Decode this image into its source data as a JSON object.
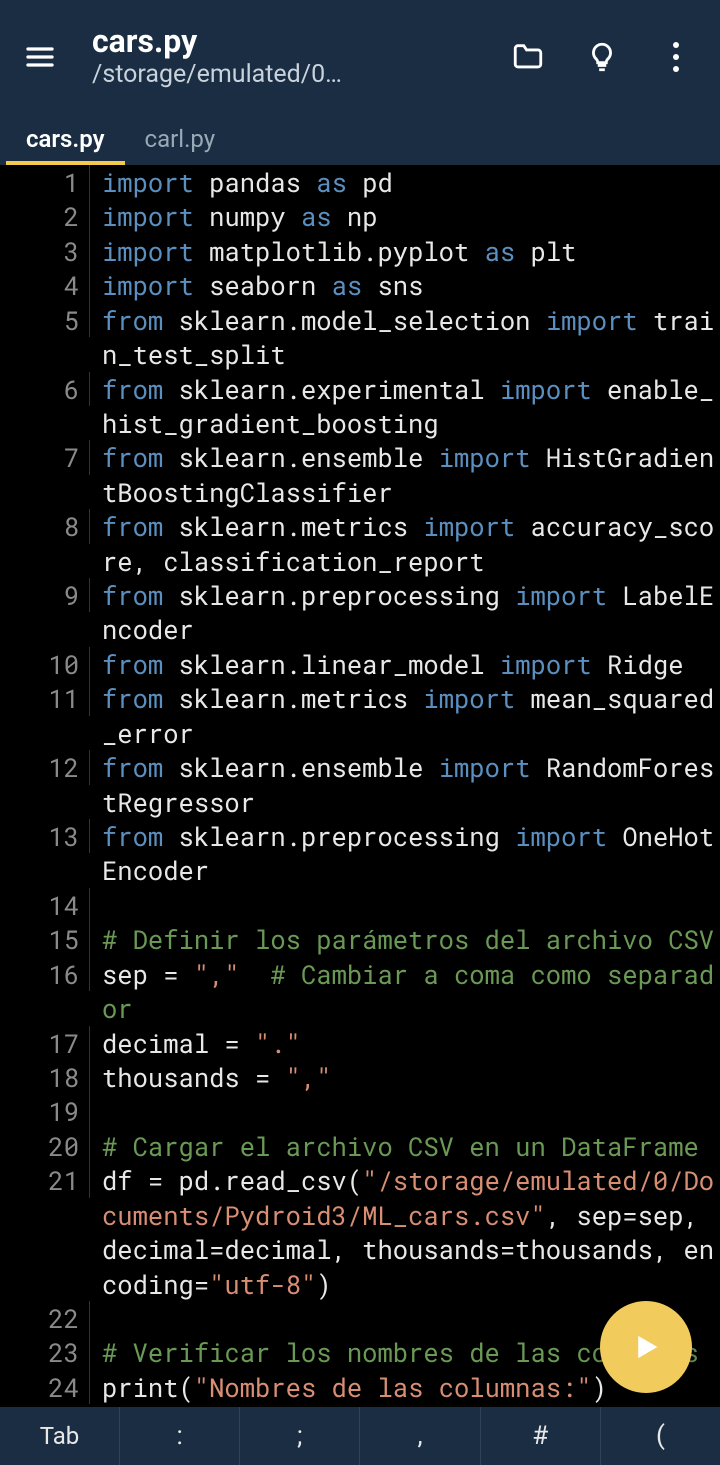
{
  "header": {
    "title": "cars.py",
    "subtitle": "/storage/emulated/0…"
  },
  "tabs": [
    {
      "label": "cars.py",
      "active": true
    },
    {
      "label": "carl.py",
      "active": false
    }
  ],
  "code_lines": [
    {
      "n": 1,
      "tokens": [
        [
          "kw-import",
          "import"
        ],
        [
          "sp",
          " "
        ],
        [
          "ident",
          "pandas"
        ],
        [
          "sp",
          " "
        ],
        [
          "kw-as",
          "as"
        ],
        [
          "sp",
          " "
        ],
        [
          "ident",
          "pd"
        ]
      ]
    },
    {
      "n": 2,
      "tokens": [
        [
          "kw-import",
          "import"
        ],
        [
          "sp",
          " "
        ],
        [
          "ident",
          "numpy"
        ],
        [
          "sp",
          " "
        ],
        [
          "kw-as",
          "as"
        ],
        [
          "sp",
          " "
        ],
        [
          "ident",
          "np"
        ]
      ]
    },
    {
      "n": 3,
      "tokens": [
        [
          "kw-import",
          "import"
        ],
        [
          "sp",
          " "
        ],
        [
          "ident",
          "matplotlib.pyplot"
        ],
        [
          "sp",
          " "
        ],
        [
          "kw-as",
          "as"
        ],
        [
          "sp",
          " "
        ],
        [
          "ident",
          "plt"
        ]
      ]
    },
    {
      "n": 4,
      "tokens": [
        [
          "kw-import",
          "import"
        ],
        [
          "sp",
          " "
        ],
        [
          "ident",
          "seaborn"
        ],
        [
          "sp",
          " "
        ],
        [
          "kw-as",
          "as"
        ],
        [
          "sp",
          " "
        ],
        [
          "ident",
          "sns"
        ]
      ]
    },
    {
      "n": 5,
      "tokens": [
        [
          "kw-from",
          "from"
        ],
        [
          "sp",
          " "
        ],
        [
          "ident",
          "sklearn.model_selection"
        ],
        [
          "sp",
          " "
        ],
        [
          "kw-import",
          "import"
        ],
        [
          "sp",
          " "
        ],
        [
          "ident",
          "train_test_split"
        ]
      ]
    },
    {
      "n": 6,
      "tokens": [
        [
          "kw-from",
          "from"
        ],
        [
          "sp",
          " "
        ],
        [
          "ident",
          "sklearn.experimental"
        ],
        [
          "sp",
          " "
        ],
        [
          "kw-import",
          "import"
        ],
        [
          "sp",
          " "
        ],
        [
          "ident",
          "enable_hist_gradient_boosting"
        ]
      ]
    },
    {
      "n": 7,
      "tokens": [
        [
          "kw-from",
          "from"
        ],
        [
          "sp",
          " "
        ],
        [
          "ident",
          "sklearn.ensemble"
        ],
        [
          "sp",
          " "
        ],
        [
          "kw-import",
          "import"
        ],
        [
          "sp",
          " "
        ],
        [
          "ident",
          "HistGradientBoostingClassifier"
        ]
      ]
    },
    {
      "n": 8,
      "tokens": [
        [
          "kw-from",
          "from"
        ],
        [
          "sp",
          " "
        ],
        [
          "ident",
          "sklearn.metrics"
        ],
        [
          "sp",
          " "
        ],
        [
          "kw-import",
          "import"
        ],
        [
          "sp",
          " "
        ],
        [
          "ident",
          "accuracy_score, classification_report"
        ]
      ]
    },
    {
      "n": 9,
      "tokens": [
        [
          "kw-from",
          "from"
        ],
        [
          "sp",
          " "
        ],
        [
          "ident",
          "sklearn.preprocessing"
        ],
        [
          "sp",
          " "
        ],
        [
          "kw-import",
          "import"
        ],
        [
          "sp",
          " "
        ],
        [
          "ident",
          "LabelEncoder"
        ]
      ]
    },
    {
      "n": 10,
      "tokens": [
        [
          "kw-from",
          "from"
        ],
        [
          "sp",
          " "
        ],
        [
          "ident",
          "sklearn.linear_model"
        ],
        [
          "sp",
          " "
        ],
        [
          "kw-import",
          "import"
        ],
        [
          "sp",
          " "
        ],
        [
          "ident",
          "Ridge"
        ]
      ]
    },
    {
      "n": 11,
      "tokens": [
        [
          "kw-from",
          "from"
        ],
        [
          "sp",
          " "
        ],
        [
          "ident",
          "sklearn.metrics"
        ],
        [
          "sp",
          " "
        ],
        [
          "kw-import",
          "import"
        ],
        [
          "sp",
          " "
        ],
        [
          "ident",
          "mean_squared_error"
        ]
      ]
    },
    {
      "n": 12,
      "tokens": [
        [
          "kw-from",
          "from"
        ],
        [
          "sp",
          " "
        ],
        [
          "ident",
          "sklearn.ensemble"
        ],
        [
          "sp",
          " "
        ],
        [
          "kw-import",
          "import"
        ],
        [
          "sp",
          " "
        ],
        [
          "ident",
          "RandomForestRegressor"
        ]
      ]
    },
    {
      "n": 13,
      "tokens": [
        [
          "kw-from",
          "from"
        ],
        [
          "sp",
          " "
        ],
        [
          "ident",
          "sklearn.preprocessing"
        ],
        [
          "sp",
          " "
        ],
        [
          "kw-import",
          "import"
        ],
        [
          "sp",
          " "
        ],
        [
          "ident",
          "OneHotEncoder"
        ]
      ]
    },
    {
      "n": 14,
      "tokens": []
    },
    {
      "n": 15,
      "tokens": [
        [
          "comment",
          "# Definir los parámetros del archivo CSV"
        ]
      ]
    },
    {
      "n": 16,
      "tokens": [
        [
          "ident",
          "sep = "
        ],
        [
          "string",
          "\",\""
        ],
        [
          "ident",
          "  "
        ],
        [
          "comment",
          "# Cambiar a coma como separador"
        ]
      ]
    },
    {
      "n": 17,
      "tokens": [
        [
          "ident",
          "decimal = "
        ],
        [
          "string",
          "\".\""
        ]
      ]
    },
    {
      "n": 18,
      "tokens": [
        [
          "ident",
          "thousands = "
        ],
        [
          "string",
          "\",\""
        ]
      ]
    },
    {
      "n": 19,
      "tokens": []
    },
    {
      "n": 20,
      "tokens": [
        [
          "comment",
          "# Cargar el archivo CSV en un DataFrame"
        ]
      ]
    },
    {
      "n": 21,
      "tokens": [
        [
          "ident",
          "df = pd.read_csv("
        ],
        [
          "string",
          "\"/storage/emulated/0/Documents/Pydroid3/ML_cars.csv\""
        ],
        [
          "ident",
          ", sep=sep, decimal=decimal, thousands=thousands, encoding="
        ],
        [
          "string",
          "\"utf-8\""
        ],
        [
          "ident",
          ")"
        ]
      ]
    },
    {
      "n": 22,
      "tokens": []
    },
    {
      "n": 23,
      "tokens": [
        [
          "comment",
          "# Verificar los nombres de las columnas"
        ]
      ]
    },
    {
      "n": 24,
      "tokens": [
        [
          "ident",
          "print("
        ],
        [
          "string",
          "\"Nombres de las columnas:\""
        ],
        [
          "ident",
          ")"
        ]
      ]
    }
  ],
  "bottom_keys": [
    "Tab",
    ":",
    ";",
    ",",
    "#",
    "("
  ]
}
